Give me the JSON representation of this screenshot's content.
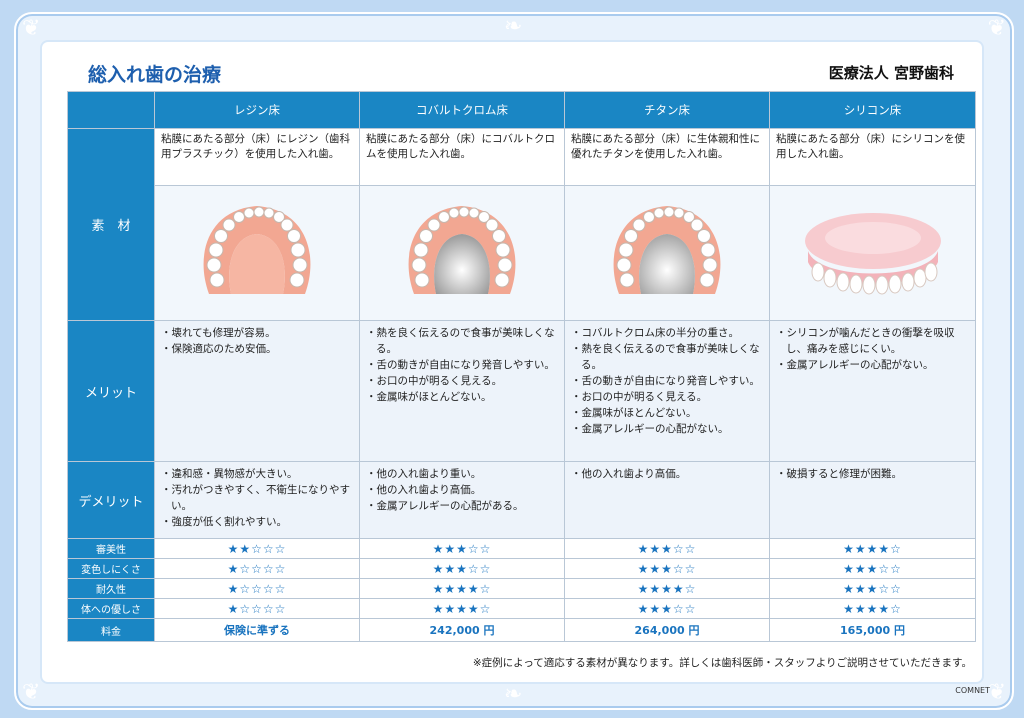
{
  "title": "総入れ歯の治療",
  "clinic": "医療法人 宮野歯科",
  "columns": [
    "レジン床",
    "コバルトクロム床",
    "チタン床",
    "シリコン床"
  ],
  "rows": {
    "material": "素　材",
    "merit": "メリット",
    "demerit": "デメリット"
  },
  "descriptions": [
    "粘膜にあたる部分（床）にレジン（歯科用プラスチック）を使用した入れ歯。",
    "粘膜にあたる部分（床）にコバルトクロムを使用した入れ歯。",
    "粘膜にあたる部分（床）に生体親和性に優れたチタンを使用した入れ歯。",
    "粘膜にあたる部分（床）にシリコンを使用した入れ歯。"
  ],
  "images": [
    "resin-denture",
    "cobalt-chrome-denture",
    "titanium-denture",
    "silicone-denture"
  ],
  "merits": [
    [
      "・壊れても修理が容易。",
      "・保険適応のため安価。"
    ],
    [
      "・熱を良く伝えるので食事が美味しくなる。",
      "・舌の動きが自由になり発音しやすい。",
      "・お口の中が明るく見える。",
      "・金属味がほとんどない。"
    ],
    [
      "・コバルトクロム床の半分の重さ。",
      "・熱を良く伝えるので食事が美味しくなる。",
      "・舌の動きが自由になり発音しやすい。",
      "・お口の中が明るく見える。",
      "・金属味がほとんどない。",
      "・金属アレルギーの心配がない。"
    ],
    [
      "・シリコンが噛んだときの衝撃を吸収し、痛みを感じにくい。",
      "・金属アレルギーの心配がない。"
    ]
  ],
  "demerits": [
    [
      "・違和感・異物感が大きい。",
      "・汚れがつきやすく、不衛生になりやすい。",
      "・強度が低く割れやすい。"
    ],
    [
      "・他の入れ歯より重い。",
      "・他の入れ歯より高価。",
      "・金属アレルギーの心配がある。"
    ],
    [
      "・他の入れ歯より高価。"
    ],
    [
      "・破損すると修理が困難。"
    ]
  ],
  "ratings": [
    {
      "label": "審美性",
      "values": [
        "★★☆☆☆",
        "★★★☆☆",
        "★★★☆☆",
        "★★★★☆"
      ]
    },
    {
      "label": "変色しにくさ",
      "values": [
        "★☆☆☆☆",
        "★★★☆☆",
        "★★★☆☆",
        "★★★☆☆"
      ]
    },
    {
      "label": "耐久性",
      "values": [
        "★☆☆☆☆",
        "★★★★☆",
        "★★★★☆",
        "★★★☆☆"
      ]
    },
    {
      "label": "体への優しさ",
      "values": [
        "★☆☆☆☆",
        "★★★★☆",
        "★★★☆☆",
        "★★★★☆"
      ]
    }
  ],
  "price": {
    "label": "料金",
    "values": [
      "保険に準ずる",
      "242,000 円",
      "264,000 円",
      "165,000 円"
    ]
  },
  "note": "※症例によって適応する素材が異なります。詳しくは歯科医師・スタッフよりご説明させていただきます。",
  "brand": "COMNET",
  "colors": {
    "header": "#1a86c4",
    "accent": "#1a74bf",
    "gum_resin": "#f0a48f",
    "silicone": "#f6c7cb"
  }
}
